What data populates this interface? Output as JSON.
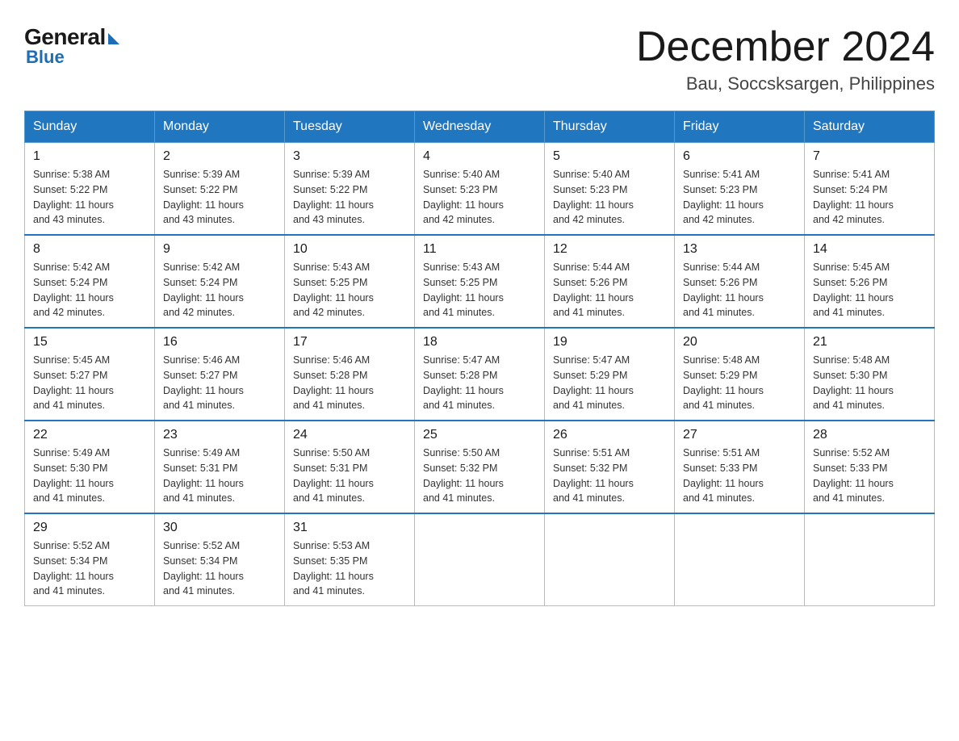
{
  "logo": {
    "general": "General",
    "blue": "Blue"
  },
  "header": {
    "month_year": "December 2024",
    "location": "Bau, Soccsksargen, Philippines"
  },
  "weekdays": [
    "Sunday",
    "Monday",
    "Tuesday",
    "Wednesday",
    "Thursday",
    "Friday",
    "Saturday"
  ],
  "weeks": [
    [
      {
        "day": "1",
        "sunrise": "5:38 AM",
        "sunset": "5:22 PM",
        "daylight": "11 hours and 43 minutes."
      },
      {
        "day": "2",
        "sunrise": "5:39 AM",
        "sunset": "5:22 PM",
        "daylight": "11 hours and 43 minutes."
      },
      {
        "day": "3",
        "sunrise": "5:39 AM",
        "sunset": "5:22 PM",
        "daylight": "11 hours and 43 minutes."
      },
      {
        "day": "4",
        "sunrise": "5:40 AM",
        "sunset": "5:23 PM",
        "daylight": "11 hours and 42 minutes."
      },
      {
        "day": "5",
        "sunrise": "5:40 AM",
        "sunset": "5:23 PM",
        "daylight": "11 hours and 42 minutes."
      },
      {
        "day": "6",
        "sunrise": "5:41 AM",
        "sunset": "5:23 PM",
        "daylight": "11 hours and 42 minutes."
      },
      {
        "day": "7",
        "sunrise": "5:41 AM",
        "sunset": "5:24 PM",
        "daylight": "11 hours and 42 minutes."
      }
    ],
    [
      {
        "day": "8",
        "sunrise": "5:42 AM",
        "sunset": "5:24 PM",
        "daylight": "11 hours and 42 minutes."
      },
      {
        "day": "9",
        "sunrise": "5:42 AM",
        "sunset": "5:24 PM",
        "daylight": "11 hours and 42 minutes."
      },
      {
        "day": "10",
        "sunrise": "5:43 AM",
        "sunset": "5:25 PM",
        "daylight": "11 hours and 42 minutes."
      },
      {
        "day": "11",
        "sunrise": "5:43 AM",
        "sunset": "5:25 PM",
        "daylight": "11 hours and 41 minutes."
      },
      {
        "day": "12",
        "sunrise": "5:44 AM",
        "sunset": "5:26 PM",
        "daylight": "11 hours and 41 minutes."
      },
      {
        "day": "13",
        "sunrise": "5:44 AM",
        "sunset": "5:26 PM",
        "daylight": "11 hours and 41 minutes."
      },
      {
        "day": "14",
        "sunrise": "5:45 AM",
        "sunset": "5:26 PM",
        "daylight": "11 hours and 41 minutes."
      }
    ],
    [
      {
        "day": "15",
        "sunrise": "5:45 AM",
        "sunset": "5:27 PM",
        "daylight": "11 hours and 41 minutes."
      },
      {
        "day": "16",
        "sunrise": "5:46 AM",
        "sunset": "5:27 PM",
        "daylight": "11 hours and 41 minutes."
      },
      {
        "day": "17",
        "sunrise": "5:46 AM",
        "sunset": "5:28 PM",
        "daylight": "11 hours and 41 minutes."
      },
      {
        "day": "18",
        "sunrise": "5:47 AM",
        "sunset": "5:28 PM",
        "daylight": "11 hours and 41 minutes."
      },
      {
        "day": "19",
        "sunrise": "5:47 AM",
        "sunset": "5:29 PM",
        "daylight": "11 hours and 41 minutes."
      },
      {
        "day": "20",
        "sunrise": "5:48 AM",
        "sunset": "5:29 PM",
        "daylight": "11 hours and 41 minutes."
      },
      {
        "day": "21",
        "sunrise": "5:48 AM",
        "sunset": "5:30 PM",
        "daylight": "11 hours and 41 minutes."
      }
    ],
    [
      {
        "day": "22",
        "sunrise": "5:49 AM",
        "sunset": "5:30 PM",
        "daylight": "11 hours and 41 minutes."
      },
      {
        "day": "23",
        "sunrise": "5:49 AM",
        "sunset": "5:31 PM",
        "daylight": "11 hours and 41 minutes."
      },
      {
        "day": "24",
        "sunrise": "5:50 AM",
        "sunset": "5:31 PM",
        "daylight": "11 hours and 41 minutes."
      },
      {
        "day": "25",
        "sunrise": "5:50 AM",
        "sunset": "5:32 PM",
        "daylight": "11 hours and 41 minutes."
      },
      {
        "day": "26",
        "sunrise": "5:51 AM",
        "sunset": "5:32 PM",
        "daylight": "11 hours and 41 minutes."
      },
      {
        "day": "27",
        "sunrise": "5:51 AM",
        "sunset": "5:33 PM",
        "daylight": "11 hours and 41 minutes."
      },
      {
        "day": "28",
        "sunrise": "5:52 AM",
        "sunset": "5:33 PM",
        "daylight": "11 hours and 41 minutes."
      }
    ],
    [
      {
        "day": "29",
        "sunrise": "5:52 AM",
        "sunset": "5:34 PM",
        "daylight": "11 hours and 41 minutes."
      },
      {
        "day": "30",
        "sunrise": "5:52 AM",
        "sunset": "5:34 PM",
        "daylight": "11 hours and 41 minutes."
      },
      {
        "day": "31",
        "sunrise": "5:53 AM",
        "sunset": "5:35 PM",
        "daylight": "11 hours and 41 minutes."
      },
      null,
      null,
      null,
      null
    ]
  ],
  "labels": {
    "sunrise": "Sunrise:",
    "sunset": "Sunset:",
    "daylight": "Daylight:"
  }
}
